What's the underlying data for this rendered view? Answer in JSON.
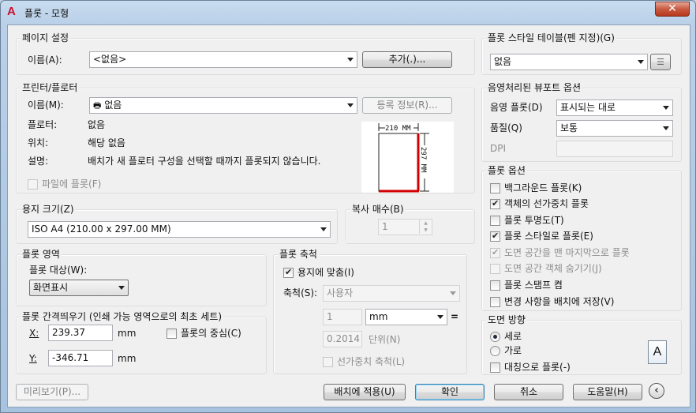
{
  "window": {
    "title": "플롯 - 모형",
    "close_label": "✕"
  },
  "page_setup": {
    "group_title": "페이지 설정",
    "name_label": "이름(A):",
    "name_value": "<없음>",
    "add_button": "추가(.)..."
  },
  "printer": {
    "group_title": "프린터/플로터",
    "name_label": "이름(M):",
    "name_value": "없음",
    "properties_button": "등록 정보(R)...",
    "plotter_label": "플로터:",
    "plotter_value": "없음",
    "where_label": "위치:",
    "where_value": "해당 없음",
    "description_label": "설명:",
    "description_value": "배치가 새 플로터 구성을 선택할 때까지 플롯되지 않습니다.",
    "plot_to_file": "파일에 플롯(F)",
    "preview_width": "210 MM",
    "preview_height": "297 MM"
  },
  "paper_size": {
    "group_title": "용지 크기(Z)",
    "value": "ISO A4 (210.00 x 297.00 MM)"
  },
  "copies": {
    "group_title": "복사 매수(B)",
    "value": "1"
  },
  "plot_area": {
    "group_title": "플롯 영역",
    "what_label": "플롯 대상(W):",
    "what_value": "화면표시"
  },
  "plot_offset": {
    "group_title": "플롯 간격띄우기 (인쇄 가능 영역으로의 최초 세트)",
    "x_label": "X:",
    "x_value": "239.37",
    "x_unit": "mm",
    "y_label": "Y:",
    "y_value": "-346.71",
    "y_unit": "mm",
    "center": "플롯의 중심(C)"
  },
  "plot_scale": {
    "group_title": "플롯 축척",
    "fit_to_paper": "용지에 맞춤(I)",
    "scale_label": "축척(S):",
    "scale_value": "사용자",
    "value1": "1",
    "unit_value": "mm",
    "equals": "=",
    "value2": "0.2014",
    "unit_label": "단위(N)",
    "scale_lineweights": "선가중치 축척(L)"
  },
  "plot_style_table": {
    "group_title": "플롯 스타일 테이블(펜 지정)(G)",
    "value": "없음",
    "edit_icon": "edit-list-icon"
  },
  "shaded_viewport": {
    "group_title": "음영처리된 뷰포트 옵션",
    "shade_label": "음영 플롯(D)",
    "shade_value": "표시되는 대로",
    "quality_label": "품질(Q)",
    "quality_value": "보통",
    "dpi_label": "DPI"
  },
  "plot_options": {
    "group_title": "플롯 옵션",
    "items": [
      {
        "label": "백그라운드 플롯(K)",
        "checked": false,
        "disabled": false
      },
      {
        "label": "객체의 선가중치 플롯",
        "checked": true,
        "disabled": false
      },
      {
        "label": "플롯 투명도(T)",
        "checked": false,
        "disabled": false
      },
      {
        "label": "플롯 스타일로 플롯(E)",
        "checked": true,
        "disabled": false
      },
      {
        "label": "도면 공간을 맨 마지막으로 플롯",
        "checked": true,
        "disabled": true
      },
      {
        "label": "도면 공간 객체 숨기기(J)",
        "checked": false,
        "disabled": true
      },
      {
        "label": "플롯 스탬프 켬",
        "checked": false,
        "disabled": false
      },
      {
        "label": "변경 사항을 배치에 저장(V)",
        "checked": false,
        "disabled": false
      }
    ]
  },
  "orientation": {
    "group_title": "도면 방향",
    "portrait": "세로",
    "landscape": "가로",
    "upside_down": "대칭으로 플롯(-)",
    "paper_icon_letter": "A"
  },
  "footer": {
    "preview": "미리보기(P)...",
    "apply_to_layout": "배치에 적용(U)",
    "ok": "확인",
    "cancel": "취소",
    "help": "도움말(H)",
    "collapse_icon": "chevron-left-circle-icon"
  }
}
